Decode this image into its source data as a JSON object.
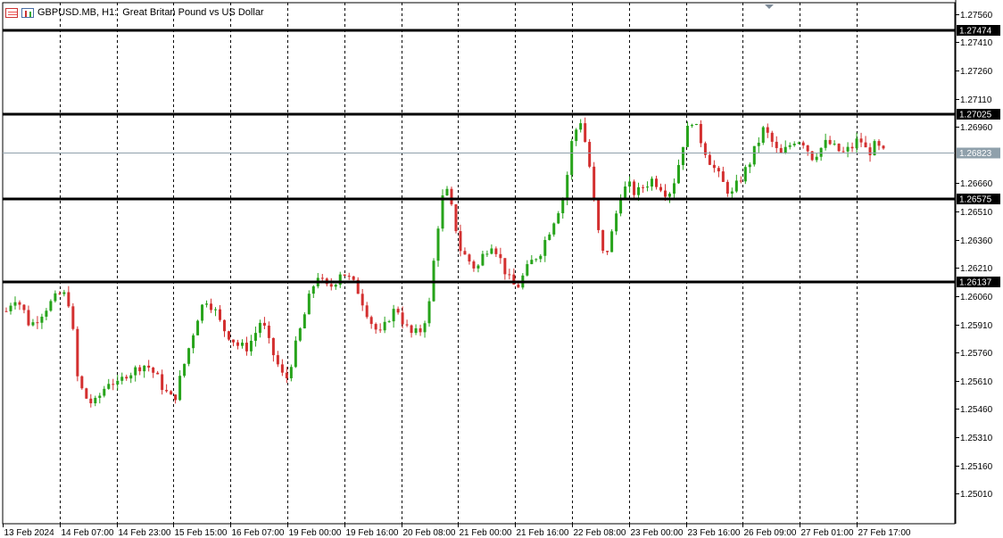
{
  "header": {
    "symbol": "GBPUSD.MB, H1:",
    "description": "Great Britan Pound vs US Dollar"
  },
  "colors": {
    "bull": "#26a31a",
    "bear": "#d32f2f",
    "grid": "#000000",
    "level": "#000000",
    "bid_line": "#8fa0ab",
    "bid_tag": "#8fa0ab"
  },
  "chart_data": {
    "type": "candlestick",
    "ylim": [
      1.2485,
      1.2762
    ],
    "y_ticks": [
      "1.27560",
      "1.27410",
      "1.27260",
      "1.27110",
      "1.26960",
      "1.26660",
      "1.26510",
      "1.26360",
      "1.26210",
      "1.26060",
      "1.25910",
      "1.25760",
      "1.25610",
      "1.25460",
      "1.25310",
      "1.25160",
      "1.25010"
    ],
    "x_ticks": [
      "13 Feb 2024",
      "14 Feb 07:00",
      "14 Feb 23:00",
      "15 Feb 15:00",
      "16 Feb 07:00",
      "19 Feb 00:00",
      "19 Feb 16:00",
      "20 Feb 08:00",
      "21 Feb 00:00",
      "21 Feb 16:00",
      "22 Feb 08:00",
      "23 Feb 00:00",
      "23 Feb 16:00",
      "26 Feb 09:00",
      "27 Feb 01:00",
      "27 Feb 17:00"
    ],
    "levels": [
      {
        "label": "1.27474",
        "value": 1.27474
      },
      {
        "label": "1.27025",
        "value": 1.27025
      },
      {
        "label": "1.26575",
        "value": 1.26575
      },
      {
        "label": "1.26137",
        "value": 1.26137
      }
    ],
    "bid": {
      "label": "1.26823",
      "value": 1.26823
    },
    "close_path": [
      1.2598,
      1.2606,
      1.26,
      1.259,
      1.2595,
      1.26,
      1.2604,
      1.2608,
      1.2602,
      1.256,
      1.2552,
      1.2548,
      1.2555,
      1.2562,
      1.2558,
      1.2565,
      1.2566,
      1.257,
      1.2568,
      1.2562,
      1.2555,
      1.255,
      1.2565,
      1.258,
      1.2595,
      1.2605,
      1.26,
      1.259,
      1.2585,
      1.258,
      1.2578,
      1.2584,
      1.2594,
      1.258,
      1.257,
      1.256,
      1.2575,
      1.259,
      1.2605,
      1.2618,
      1.261,
      1.2612,
      1.262,
      1.2615,
      1.261,
      1.26,
      1.259,
      1.2585,
      1.2595,
      1.26,
      1.259,
      1.2585,
      1.2588,
      1.26,
      1.264,
      1.2665,
      1.265,
      1.263,
      1.2625,
      1.262,
      1.263,
      1.2635,
      1.2625,
      1.2615,
      1.261,
      1.2618,
      1.2625,
      1.263,
      1.264,
      1.265,
      1.266,
      1.269,
      1.27,
      1.268,
      1.2645,
      1.2625,
      1.264,
      1.266,
      1.2665,
      1.266,
      1.2665,
      1.2668,
      1.2665,
      1.266,
      1.267,
      1.269,
      1.27,
      1.269,
      1.268,
      1.2672,
      1.2665,
      1.266,
      1.2668,
      1.2675,
      1.2685,
      1.2695,
      1.2688,
      1.268,
      1.2685,
      1.269,
      1.2688,
      1.268,
      1.2684,
      1.2688,
      1.2684,
      1.2682,
      1.2685,
      1.269,
      1.2682,
      1.2686,
      1.2682
    ]
  }
}
